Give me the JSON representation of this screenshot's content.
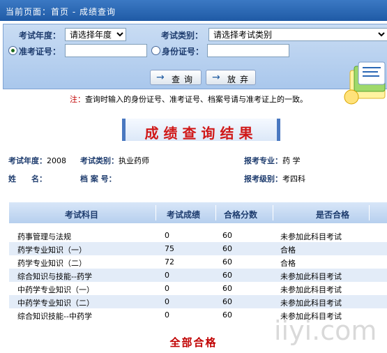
{
  "breadcrumb": "当前页面：首页 - 成绩查询",
  "search": {
    "year_label": "考试年度：",
    "year_value": "请选择年度",
    "type_label": "考试类别：",
    "type_value": "请选择考试类别",
    "ticket_label": "准考证号：",
    "id_label": "身份证号：",
    "query_button": "查询",
    "giveup_button": "放弃"
  },
  "note": {
    "prefix": "注：",
    "text": "查询时输入的身份证号、准考证号、档案号请与准考证上的一致。"
  },
  "result_title": "成绩查询结果",
  "info": {
    "year_label": "考试年度：",
    "year_value": "2008",
    "type_label": "考试类别：",
    "type_value": "执业药师",
    "major_label": "报考专业：",
    "major_value": "药 学",
    "name_label": "姓　　名：",
    "file_label": "档 案 号：",
    "level_label": "报考级别：",
    "level_value": "考四科"
  },
  "table": {
    "headers": [
      "考试科目",
      "考试成绩",
      "合格分数",
      "是否合格"
    ],
    "rows": [
      [
        "药事管理与法规",
        "0",
        "60",
        "未参加此科目考试"
      ],
      [
        "药学专业知识（一）",
        "75",
        "60",
        "合格"
      ],
      [
        "药学专业知识（二）",
        "72",
        "60",
        "合格"
      ],
      [
        "综合知识与技能--药学",
        "0",
        "60",
        "未参加此科目考试"
      ],
      [
        "中药学专业知识（一）",
        "0",
        "60",
        "未参加此科目考试"
      ],
      [
        "中药学专业知识（二）",
        "0",
        "60",
        "未参加此科目考试"
      ],
      [
        "综合知识技能--中药学",
        "0",
        "60",
        "未参加此科目考试"
      ]
    ]
  },
  "overall_result": "全部合格",
  "watermark": "iiyi.com",
  "colors": {
    "accent": "#2b68b5",
    "result_red": "#c00000"
  }
}
